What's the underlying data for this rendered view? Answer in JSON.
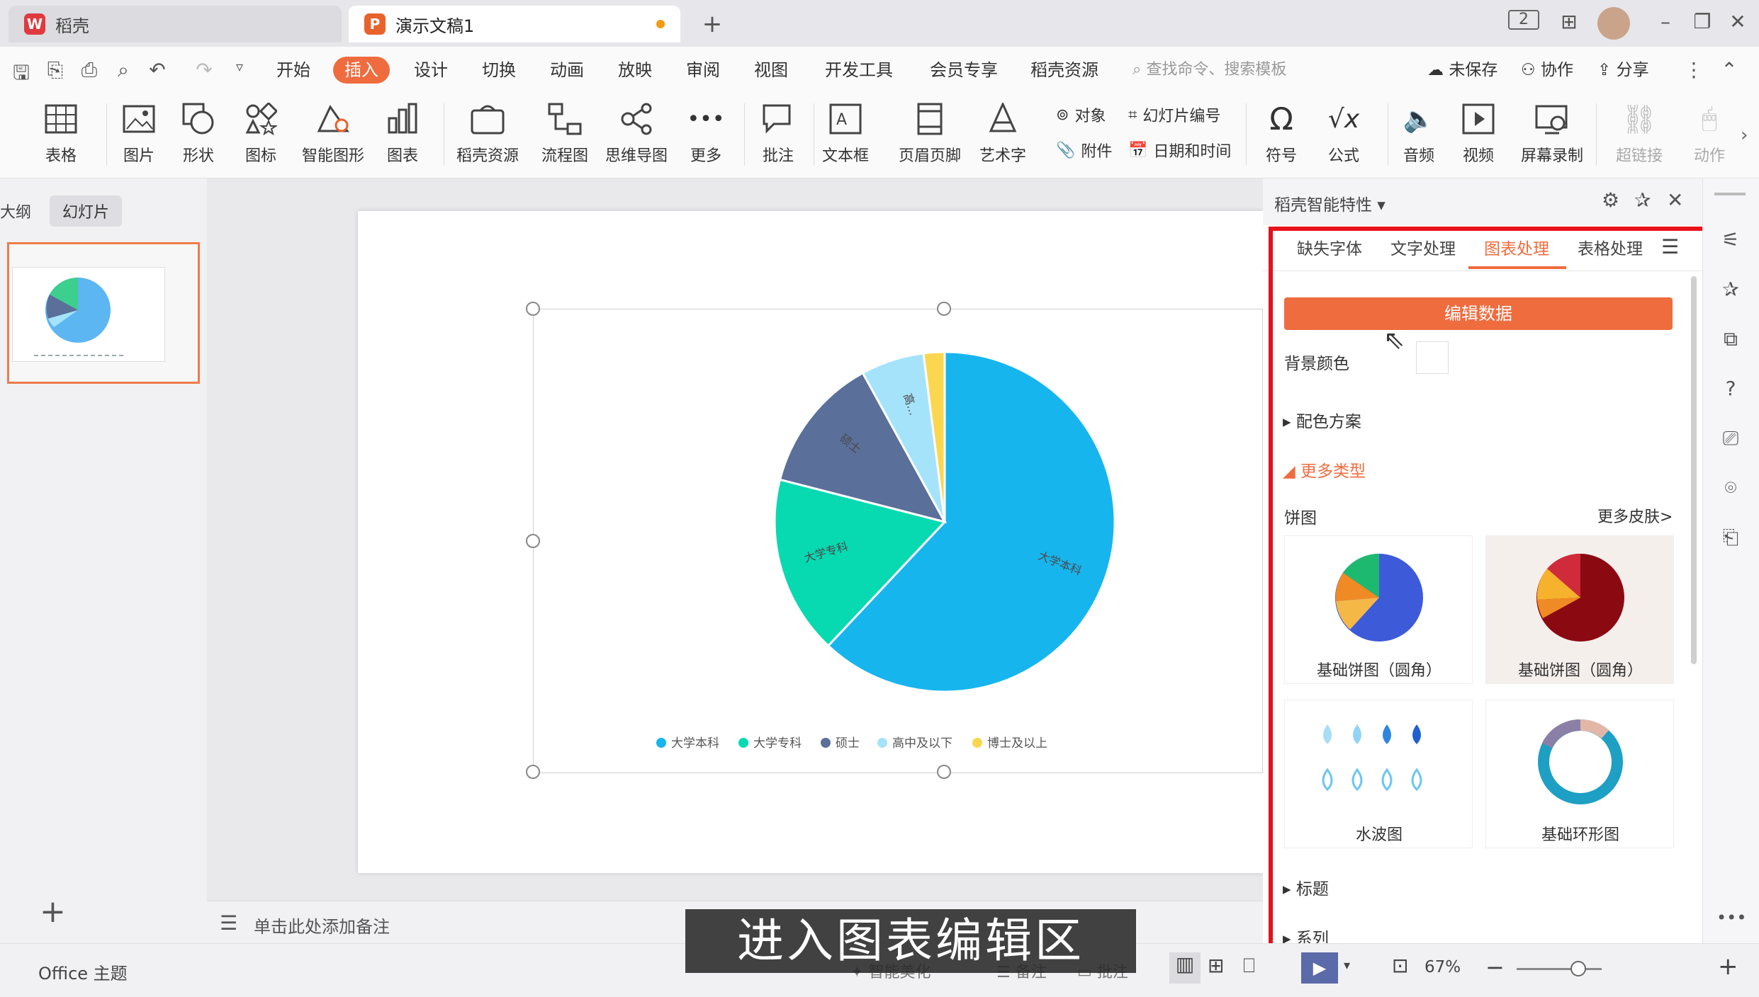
{
  "app": {
    "home_tab": "稻壳",
    "doc_tab": "演示文稿1"
  },
  "menu": {
    "items": [
      "开始",
      "插入",
      "设计",
      "切换",
      "动画",
      "放映",
      "审阅",
      "视图",
      "开发工具",
      "会员专享",
      "稻壳资源"
    ],
    "active": "插入",
    "search_placeholder": "查找命令、搜索模板",
    "unsaved": "未保存",
    "collab": "协作",
    "share": "分享"
  },
  "ribbon": {
    "table": "表格",
    "picture": "图片",
    "shape": "形状",
    "icon": "图标",
    "smartart": "智能图形",
    "chart": "图表",
    "docer": "稻壳资源",
    "flow": "流程图",
    "mindmap": "思维导图",
    "more": "更多",
    "comment": "批注",
    "textbox": "文本框",
    "header_footer": "页眉页脚",
    "wordart": "艺术字",
    "object": "对象",
    "slide_no": "幻灯片编号",
    "attach": "附件",
    "datetime": "日期和时间",
    "symbol": "符号",
    "formula": "公式",
    "audio": "音频",
    "video": "视频",
    "screenrec": "屏幕录制",
    "hyperlink": "超链接",
    "action": "动作"
  },
  "left_panel": {
    "tab_outline": "大纲",
    "tab_slides": "幻灯片"
  },
  "notes_placeholder": "单击此处添加备注",
  "status": {
    "theme": "Office 主题",
    "zoom": "67%",
    "smart_beautify": "智能美化",
    "notes": "备注",
    "comments": "批注"
  },
  "subtitle": "进入图表编辑区",
  "rpanel": {
    "title": "稻壳智能特性",
    "tabs": [
      "缺失字体",
      "文字处理",
      "图表处理",
      "表格处理"
    ],
    "active_tab": "图表处理",
    "edit_data": "编辑数据",
    "bg_color": "背景颜色",
    "color_scheme": "配色方案",
    "more_types": "更多类型",
    "pie_label": "饼图",
    "more_skins": "更多皮肤>",
    "cards": [
      "基础饼图（圆角）",
      "基础饼图（圆角）",
      "水波图",
      "基础环形图"
    ],
    "title_section": "标题",
    "series_section": "系列"
  },
  "colors": {
    "accent": "#ef6c3e",
    "highlight_frame": "#e8111b"
  },
  "chart_data": {
    "type": "pie",
    "categories": [
      "大学本科",
      "大学专科",
      "硕士",
      "高中及以下",
      "博士及以上"
    ],
    "values": [
      62,
      17,
      13,
      6,
      2
    ],
    "colors": [
      "#17b5ee",
      "#07d9b1",
      "#5a6f99",
      "#a5e3fa",
      "#fbd64f"
    ],
    "data_labels": [
      "大学本科",
      "大学专科",
      "硕士",
      "高...",
      ""
    ],
    "legend_position": "bottom"
  }
}
